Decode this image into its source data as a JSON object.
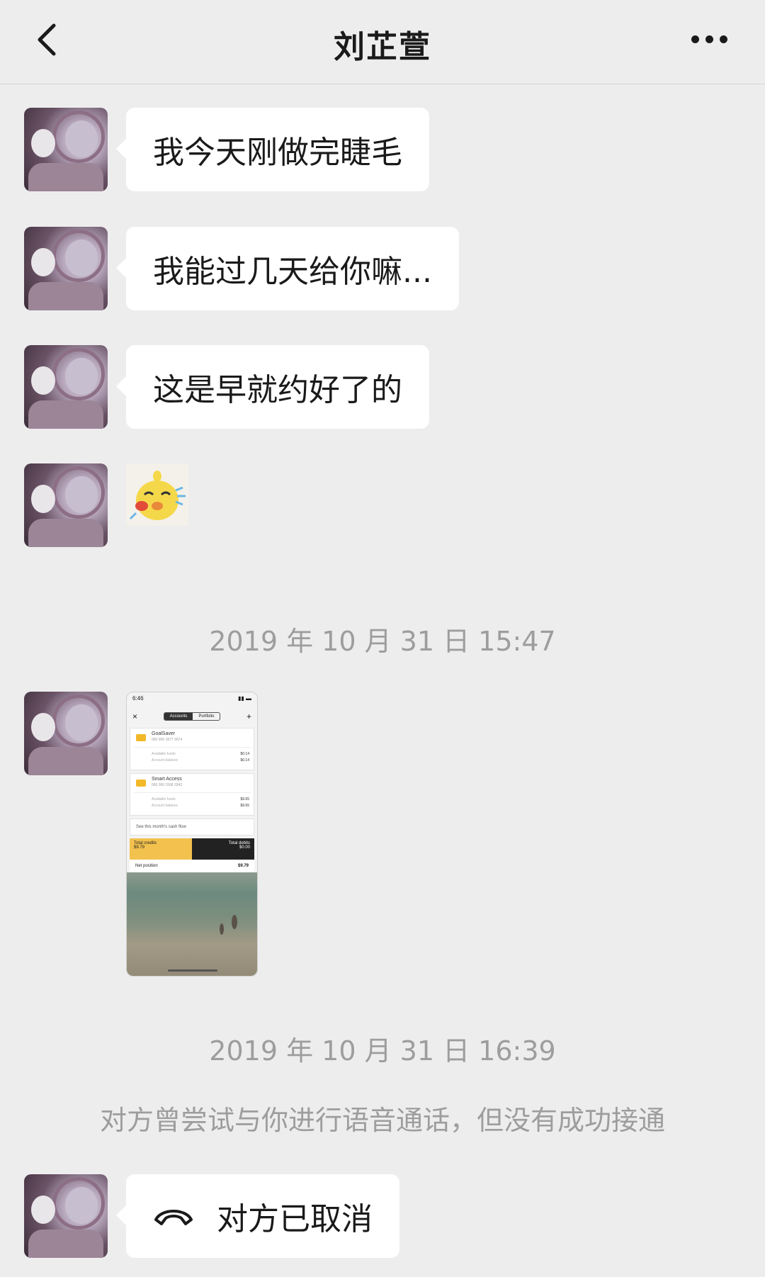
{
  "header": {
    "title": "刘芷萱"
  },
  "messages": [
    {
      "text": "我今天刚做完睫毛"
    },
    {
      "text": "我能过几天给你嘛..."
    },
    {
      "text": "这是早就约好了的"
    }
  ],
  "timestamps": [
    "2019 年 10 月 31 日 15:47",
    "2019 年 10 月 31 日 16:39"
  ],
  "system_note": "对方曾尝试与你进行语音通话，但没有成功接通",
  "call_bubble": {
    "text": "对方已取消",
    "icon": "phone-hangup-icon"
  },
  "screenshot": {
    "status_time": "6:46",
    "tab_accounts": "Accounts",
    "tab_portfolio": "Portfolio",
    "account1": {
      "name": "GoalSaver",
      "number": "060 000 1877 3074",
      "available_label": "Available funds",
      "balance_label": "Account balance",
      "available": "$0.14",
      "balance": "$0.14"
    },
    "account2": {
      "name": "Smart Access",
      "number": "060 000 1568 3342",
      "available_label": "Available funds",
      "balance_label": "Account balance",
      "available": "$9.65",
      "balance": "$9.65"
    },
    "cash_flow": "See this month's cash flow",
    "credits_label": "Total credits",
    "credits": "$9.79",
    "debits_label": "Total debits",
    "debits": "$0.00",
    "net_label": "Net position",
    "net": "$9.79"
  }
}
